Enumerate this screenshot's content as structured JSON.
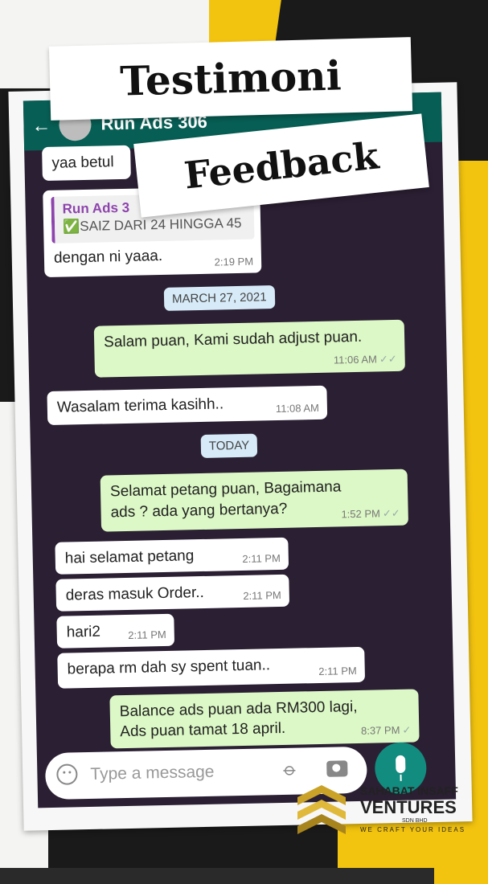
{
  "overlay": {
    "title_line1": "Testimoni",
    "title_line2": "Feedback"
  },
  "chat": {
    "header": {
      "contact_name": "Run Ads 306"
    },
    "messages": [
      {
        "direction": "in",
        "text": "yaa betul"
      },
      {
        "direction": "in",
        "quote_name": "Run Ads 3",
        "quote_text": "✅SAIZ DARI 24 HINGGA 45",
        "text": "dengan ni yaaa.",
        "time": "2:19 PM"
      },
      {
        "type": "date",
        "text": "MARCH 27, 2021"
      },
      {
        "direction": "out",
        "text": "Salam puan, Kami sudah adjust puan.",
        "time": "11:06 AM",
        "status": "✓✓"
      },
      {
        "direction": "in",
        "text": "Wasalam terima kasihh..",
        "time": "11:08 AM"
      },
      {
        "type": "date",
        "text": "TODAY"
      },
      {
        "direction": "out",
        "text_l1": "Selamat petang puan, Bagaimana",
        "text_l2": "ads ? ada yang bertanya?",
        "time": "1:52 PM",
        "status": "✓✓"
      },
      {
        "direction": "in",
        "text": "hai selamat petang",
        "time": "2:11 PM"
      },
      {
        "direction": "in",
        "text": "deras masuk Order..",
        "time": "2:11 PM"
      },
      {
        "direction": "in",
        "text": "hari2",
        "time": "2:11 PM"
      },
      {
        "direction": "in",
        "text": "berapa rm dah sy spent tuan..",
        "time": "2:11 PM"
      },
      {
        "direction": "out",
        "text_l1": "Balance ads puan ada RM300 lagi,",
        "text_l2": "Ads puan tamat 18 april.",
        "time": "8:37 PM",
        "status": "✓"
      }
    ],
    "input": {
      "placeholder": "Type a message"
    }
  },
  "brand": {
    "line1": "SAHABAT INSAFF",
    "line2": "VENTURES",
    "line3": "SDN BHD",
    "tagline": "WE CRAFT YOUR IDEAS"
  },
  "colors": {
    "header": "#075e54",
    "chat_bg": "#2b1f33",
    "incoming": "#ffffff",
    "outgoing": "#dcf8c6",
    "accent_yellow": "#f2c30f",
    "mic": "#128c7e"
  }
}
